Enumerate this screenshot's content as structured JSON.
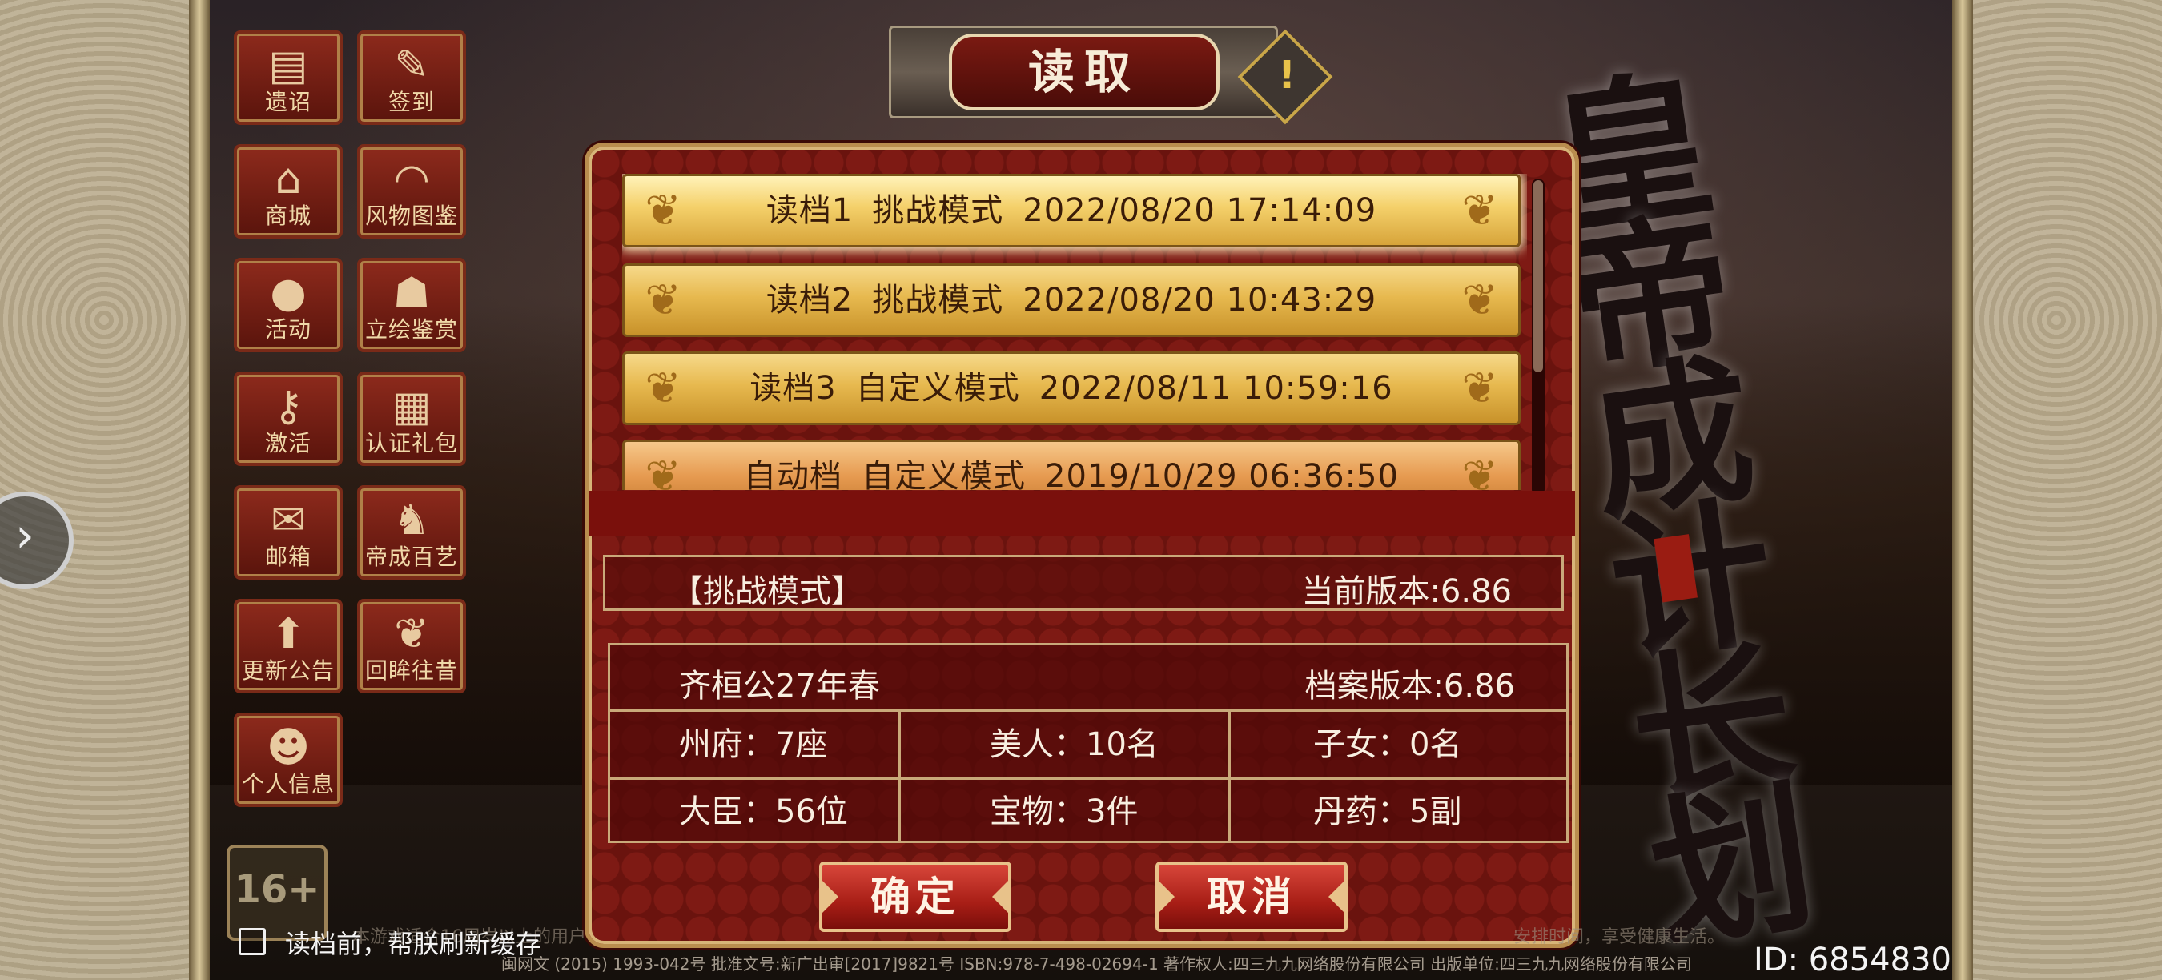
{
  "dialog": {
    "title": "读取",
    "warning_icon": "exclamation-icon",
    "slots": [
      {
        "label": "读档1",
        "mode": "挑战模式",
        "datetime": "2022/08/20 17:14:09",
        "selected": true
      },
      {
        "label": "读档2",
        "mode": "挑战模式",
        "datetime": "2022/08/20 10:43:29",
        "selected": false
      },
      {
        "label": "读档3",
        "mode": "自定义模式",
        "datetime": "2022/08/11 10:59:16",
        "selected": false
      },
      {
        "label": "自动档",
        "mode": "自定义模式",
        "datetime": "2019/10/29 06:36:50",
        "selected": false
      }
    ],
    "info": {
      "mode_tag": "【挑战模式】",
      "current_version": "当前版本:6.86",
      "save_date": "齐桓公27年春",
      "save_version": "档案版本:6.86",
      "stats": [
        {
          "label": "州府：7座"
        },
        {
          "label": "美人：10名"
        },
        {
          "label": "子女：0名"
        },
        {
          "label": "大臣：56位"
        },
        {
          "label": "宝物：3件"
        },
        {
          "label": "丹药：5副"
        }
      ]
    },
    "confirm_label": "确定",
    "cancel_label": "取消"
  },
  "menu": [
    {
      "label": "遗诏",
      "icon": "scroll-icon"
    },
    {
      "label": "签到",
      "icon": "calendar-icon"
    },
    {
      "label": "商城",
      "icon": "shop-icon"
    },
    {
      "label": "风物图鉴",
      "icon": "fan-icon"
    },
    {
      "label": "活动",
      "icon": "lantern-icon"
    },
    {
      "label": "立绘鉴赏",
      "icon": "portrait-icon"
    },
    {
      "label": "激活",
      "icon": "key-icon"
    },
    {
      "label": "认证礼包",
      "icon": "card-icon"
    },
    {
      "label": "邮箱",
      "icon": "mail-icon"
    },
    {
      "label": "帝成百艺",
      "icon": "chess-icon"
    },
    {
      "label": "更新公告",
      "icon": "up-arrow-icon"
    },
    {
      "label": "回眸往昔",
      "icon": "leaf-icon"
    },
    {
      "label": "个人信息",
      "icon": "person-icon"
    }
  ],
  "age_rating": "16+",
  "refresh_cache_label": "读档前，帮朕刷新缓存",
  "footer": {
    "publication": "闽网文 (2015) 1993-042号  批准文号:新广出审[2017]9821号  ISBN:978-7-498-02694-1  著作权人:四三九九网络股份有限公司 出版单位:四三九九网络股份有限公司",
    "notice_left": "本游戏适合16周岁以上的用户",
    "notice_right": "安排时间，享受健康生活。"
  },
  "user_id": "ID: 6854830",
  "logo_text": "皇帝成长计划",
  "colors": {
    "accent_red": "#6a130e",
    "gold": "#e7b94f",
    "frame": "#b98d4e"
  }
}
